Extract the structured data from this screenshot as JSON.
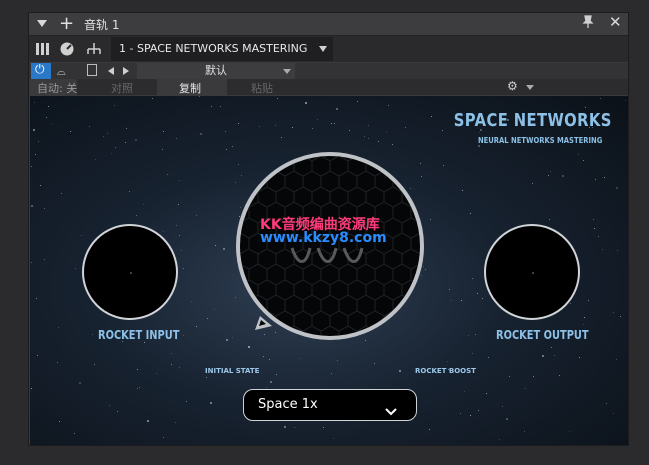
{
  "titlebar": {
    "title": "音轨 1",
    "add_icon": "+",
    "pin_icon": "pin-icon",
    "close_icon": "✕"
  },
  "toolbar": {
    "preset_selector": "1 - SPACE NETWORKS MASTERING"
  },
  "preset_row": {
    "preset_name": "默认",
    "power_icon": "⏻",
    "wave_icon": "⌓"
  },
  "command_row": {
    "auto": "自动: 关",
    "compare": "对照",
    "copy": "复制",
    "paste": "粘贴"
  },
  "plugin": {
    "brand_title": "SPACE NETWORKS",
    "brand_subtitle": "NEURAL NETWORKS MASTERING",
    "input_label": "ROCKET INPUT",
    "output_label": "ROCKET OUTPUT",
    "initial_state_label": "INITIAL STATE",
    "rocket_boost_label": "ROCKET BOOST",
    "mode_select": "Space 1x",
    "accent_color": "#8cc0e6"
  },
  "watermark": {
    "line1": "KK音频编曲资源库",
    "line2": "www.kkzy8.com"
  }
}
